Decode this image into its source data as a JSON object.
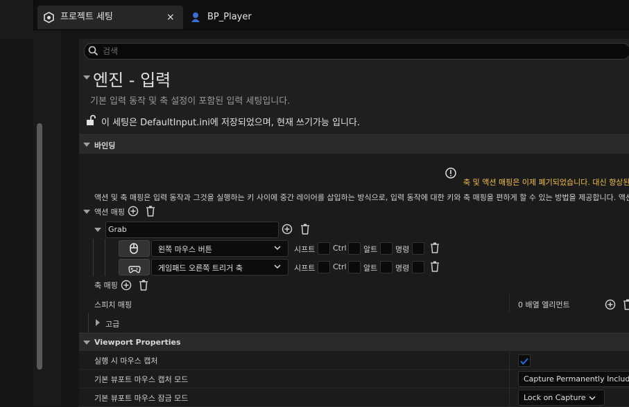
{
  "tabs": [
    {
      "label": "프로젝트 세팅",
      "close": "×",
      "icon": "settings-gear-icon"
    },
    {
      "label": "BP_Player",
      "icon": "blueprint-pawn-icon"
    }
  ],
  "search": {
    "placeholder": "검색"
  },
  "header": {
    "title": "엔진 - 입력",
    "description": "기본 입력 동작 및 축 설정이 포함된 입력 세팅입니다.",
    "save_note": "이 세팅은 DefaultInput.ini에 저장되었으며, 현재 쓰기가능 입니다."
  },
  "bindings": {
    "section_label": "바인딩",
    "deprecation_warning": "축 및 액션 매핑은 이제 폐기되었습니다. 대신 향상된",
    "explanation": "액션 및 축 매핑은 입력 동작과 그것을 실행하는 키 사이에 중간 레이어를 삽입하는 방식으로, 입력 동작에 대한 키와 축 매핑을 편하게 할 수 있는 방법을 제공합니다. 액션 매핑",
    "action_mapping_label": "액션 매핑",
    "action_name": "Grab",
    "keys": [
      {
        "icon": "mouse-icon",
        "key": "왼쪽 마우스 버튼"
      },
      {
        "icon": "gamepad-icon",
        "key": "게임패드 오른쪽 트리거 축"
      }
    ],
    "modifiers": {
      "shift": "시프트",
      "ctrl": "Ctrl",
      "alt": "알트",
      "cmd": "명령"
    },
    "axis_mapping_label": "축 매핑",
    "speech_mapping_label": "스피치 매핑",
    "speech_mapping_value": "0 배열 엘리먼트",
    "advanced_label": "고급"
  },
  "viewport": {
    "section_label": "Viewport Properties",
    "capture_on_run_label": "실행 시 마우스 캡처",
    "capture_on_run_checked": true,
    "capture_mode_label": "기본 뷰포트 마우스 캡처 모드",
    "capture_mode_value": "Capture Permanently Including",
    "lock_mode_label": "기본 뷰포트 마우스 잠금 모드",
    "lock_mode_value": "Lock on Capture"
  },
  "colors": {
    "accent": "#1a6fe0",
    "warning": "#f0c040",
    "background": "#1f1f1f"
  }
}
